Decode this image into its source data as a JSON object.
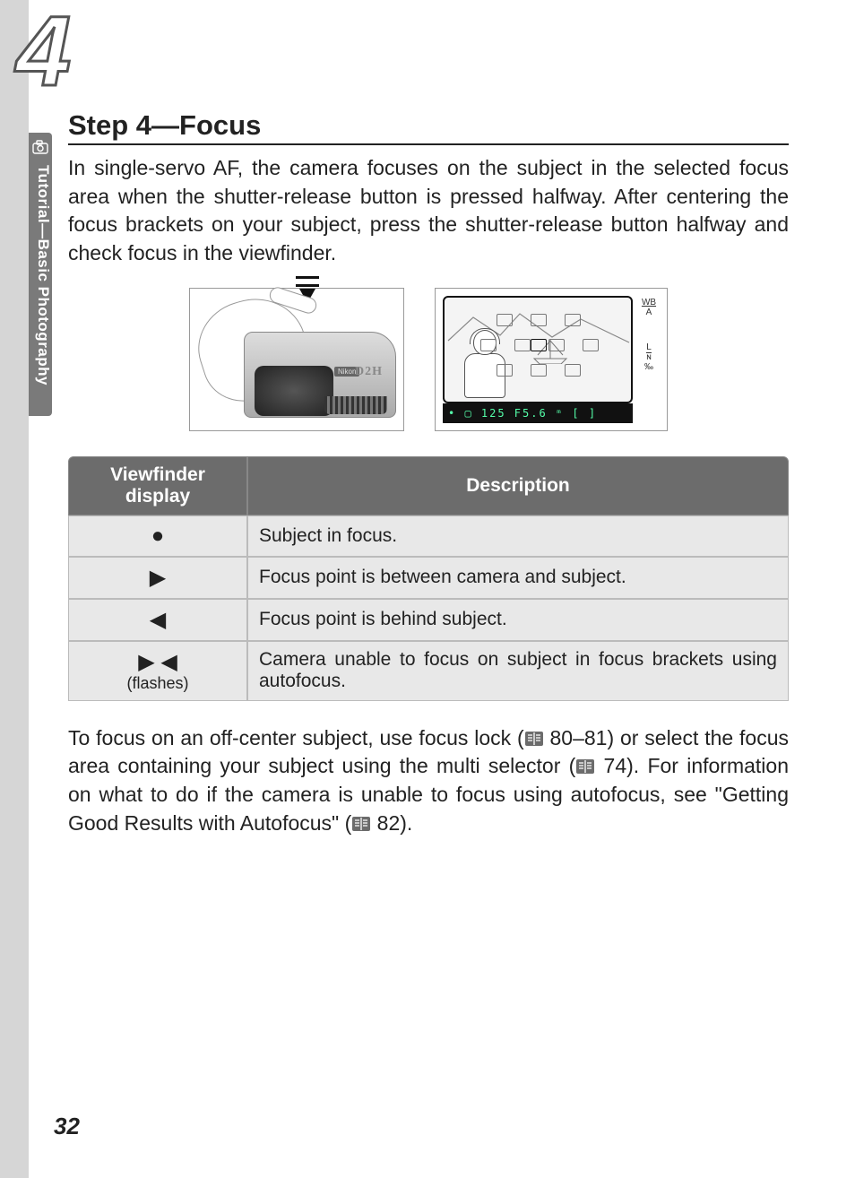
{
  "chapter_number": "4",
  "side_tab": {
    "text": "Tutorial—Basic Photography"
  },
  "heading": "Step 4—Focus",
  "intro": "In single-servo AF, the camera focuses on the subject in the selected focus area when the shutter-release button is pressed halfway.  After centering the focus brackets on your subject, press the shutter-release button halfway and check focus in the viewfinder.",
  "camera_label_model": "D2H",
  "camera_label_brand": "Nikon",
  "viewfinder_status": "• ▢   125  F5.6 ᵐ        [   ]",
  "viewfinder_side": {
    "top": "WB",
    "top2": "A",
    "bottom1": "L",
    "bottom2": "ɴ",
    "bottom3": "‰"
  },
  "table": {
    "headers": {
      "col1": "Viewfinder display",
      "col2": "Description"
    },
    "rows": [
      {
        "symbol": "●",
        "sub": "",
        "desc": "Subject in focus."
      },
      {
        "symbol": "▶",
        "sub": "",
        "desc": "Focus point is between camera and subject."
      },
      {
        "symbol": "◀",
        "sub": "",
        "desc": "Focus point is behind subject."
      },
      {
        "symbol": "▶ ◀",
        "sub": "(flashes)",
        "desc": "Camera unable to focus on subject in focus brackets using autofocus."
      }
    ]
  },
  "post": {
    "p1a": "To focus on an off-center subject, use focus lock (",
    "p1b": " 80–81) or select the focus area containing your subject using the multi selector (",
    "p1c": " 74).  For information on what to do if the camera is unable to focus using autofocus, see \"Getting Good Results with Autofocus\" (",
    "p1d": " 82)."
  },
  "page_number": "32"
}
